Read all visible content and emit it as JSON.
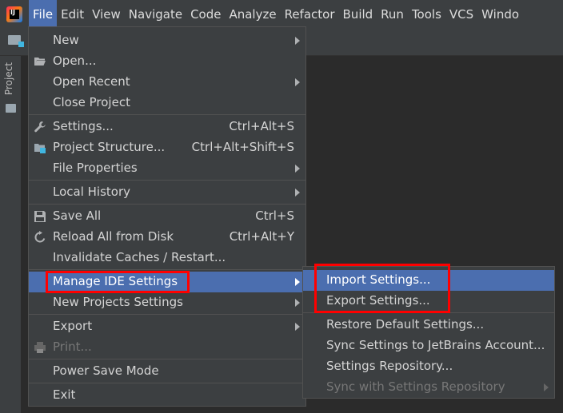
{
  "menubar": {
    "logo_text": "IJ",
    "items": [
      "File",
      "Edit",
      "View",
      "Navigate",
      "Code",
      "Analyze",
      "Refactor",
      "Build",
      "Run",
      "Tools",
      "VCS",
      "Windo"
    ]
  },
  "sidebar": {
    "tab_label": "Project"
  },
  "file_menu": {
    "new": "New",
    "open": "Open...",
    "open_recent": "Open Recent",
    "close_project": "Close Project",
    "settings": "Settings...",
    "settings_shortcut": "Ctrl+Alt+S",
    "project_structure": "Project Structure...",
    "project_structure_shortcut": "Ctrl+Alt+Shift+S",
    "file_properties": "File Properties",
    "local_history": "Local History",
    "save_all": "Save All",
    "save_all_shortcut": "Ctrl+S",
    "reload_all": "Reload All from Disk",
    "reload_all_shortcut": "Ctrl+Alt+Y",
    "invalidate_caches": "Invalidate Caches / Restart...",
    "manage_ide_settings": "Manage IDE Settings",
    "new_projects_settings": "New Projects Settings",
    "export": "Export",
    "print": "Print...",
    "power_save_mode": "Power Save Mode",
    "exit": "Exit"
  },
  "submenu": {
    "import_settings": "Import Settings...",
    "export_settings": "Export Settings...",
    "restore_default": "Restore Default Settings...",
    "sync_jetbrains": "Sync Settings to JetBrains Account...",
    "settings_repository": "Settings Repository...",
    "sync_repository": "Sync with Settings Repository"
  },
  "colors": {
    "accent": "#4b6eaf",
    "highlight_box": "#ff0000",
    "menu_bg": "#3c3f41",
    "editor_bg": "#2b2b2b"
  }
}
